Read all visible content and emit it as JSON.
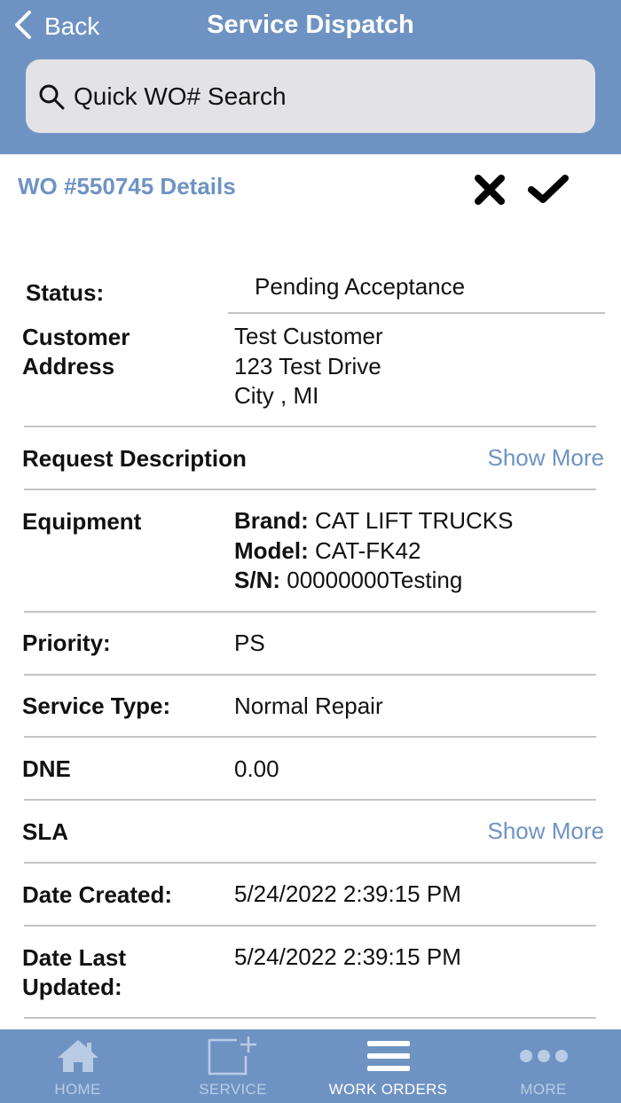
{
  "header": {
    "back_label": "Back",
    "title": "Service Dispatch",
    "search_placeholder": "Quick WO# Search"
  },
  "workorder": {
    "title": "WO #550745 Details"
  },
  "details": {
    "status_label": "Status:",
    "status_value": "Pending Acceptance",
    "customer_label_1": "Customer",
    "customer_label_2": "Address",
    "customer_name": "Test Customer",
    "customer_street": "123 Test Drive",
    "customer_city": "City , MI",
    "request_label": "Request Description",
    "request_link": "Show More",
    "equipment_label": "Equipment",
    "brand_key": "Brand:",
    "brand_value": "CAT LIFT TRUCKS",
    "model_key": "Model:",
    "model_value": "CAT-FK42",
    "sn_key": "S/N:",
    "sn_value": "00000000Testing",
    "priority_label": "Priority:",
    "priority_value": "PS",
    "service_type_label": "Service Type:",
    "service_type_value": "Normal Repair",
    "dne_label": "DNE",
    "dne_value": "0.00",
    "sla_label": "SLA",
    "sla_link": "Show More",
    "date_created_label": "Date Created:",
    "date_created_value": "5/24/2022 2:39:15 PM",
    "date_updated_label_1": "Date Last",
    "date_updated_label_2": "Updated:",
    "date_updated_value": "5/24/2022 2:39:15 PM"
  },
  "tabs": [
    {
      "label": "HOME",
      "icon": "home-icon",
      "active": false
    },
    {
      "label": "SERVICE",
      "icon": "service-add-icon",
      "active": false
    },
    {
      "label": "WORK ORDERS",
      "icon": "menu-lines-icon",
      "active": true
    },
    {
      "label": "MORE",
      "icon": "more-dots-icon",
      "active": false
    }
  ],
  "colors": {
    "accent": "#6e93c3",
    "search_bg": "#e3e3e6",
    "divider": "#c4c4c4",
    "tab_inactive": "#b9cce6"
  }
}
